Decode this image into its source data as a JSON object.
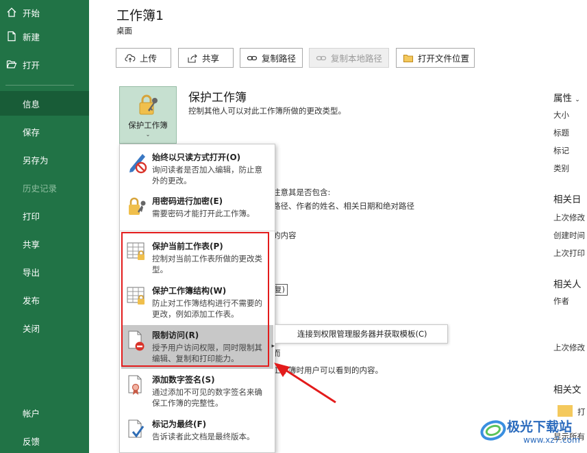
{
  "sidebar": {
    "items": [
      {
        "label": "开始",
        "icon": "home-icon"
      },
      {
        "label": "新建",
        "icon": "new-document-icon"
      },
      {
        "label": "打开",
        "icon": "open-folder-icon"
      },
      {
        "label": "信息"
      },
      {
        "label": "保存"
      },
      {
        "label": "另存为"
      },
      {
        "label": "历史记录"
      },
      {
        "label": "打印"
      },
      {
        "label": "共享"
      },
      {
        "label": "导出"
      },
      {
        "label": "发布"
      },
      {
        "label": "关闭"
      },
      {
        "label": "帐户"
      },
      {
        "label": "反馈"
      }
    ],
    "background_color": "#217346",
    "active_color": "#185c37"
  },
  "header": {
    "title": "工作簿1",
    "location": "桌面"
  },
  "toolbar": {
    "upload": "上传",
    "share": "共享",
    "copy_path": "复制路径",
    "copy_local_path": "复制本地路径",
    "open_location": "打开文件位置"
  },
  "protect": {
    "tile_label": "保护工作簿",
    "heading": "保护工作簿",
    "description": "控制其他人可以对此工作簿所做的更改类型。"
  },
  "background_fragments": {
    "line1": "注意其是否包含:",
    "line2": "路径、作者的姓名、相关日期和绝对路径",
    "line3": "的内容",
    "line4": "复)",
    "line5": "而",
    "line6": "工作簿时用户可以看到的内容。"
  },
  "properties": {
    "heading": "属性",
    "items": [
      "大小",
      "标题",
      "标记",
      "类别"
    ],
    "related_dates_heading": "相关日",
    "date_items": [
      "上次修改",
      "创建时间",
      "上次打印"
    ],
    "related_people_heading": "相关人",
    "people_items": [
      "作者",
      "上次修改"
    ],
    "related_docs_heading": "相关文",
    "doc_items": [
      "打",
      "显示所有"
    ]
  },
  "menu": {
    "items": [
      {
        "title": "始终以只读方式打开(O)",
        "desc": "询问读者是否加入编辑，防止意外的更改。"
      },
      {
        "title": "用密码进行加密(E)",
        "desc": "需要密码才能打开此工作簿。"
      },
      {
        "title": "保护当前工作表(P)",
        "desc": "控制对当前工作表所做的更改类型。"
      },
      {
        "title": "保护工作簿结构(W)",
        "desc": "防止对工作簿结构进行不需要的更改，例如添加工作表。"
      },
      {
        "title": "限制访问(R)",
        "desc": "授予用户访问权限，同时限制其编辑、复制和打印能力。"
      },
      {
        "title": "添加数字签名(S)",
        "desc": "通过添加不可见的数字签名来确保工作簿的完整性。"
      },
      {
        "title": "标记为最终(F)",
        "desc": "告诉读者此文档是最终版本。"
      }
    ],
    "submenu_label": "连接到权限管理服务器并获取模板(C)"
  },
  "colors": {
    "highlight": "#e31b1b",
    "tile": "#c6e0d0"
  },
  "watermark": {
    "name": "极光下载站",
    "url": "www.xz7.com"
  }
}
